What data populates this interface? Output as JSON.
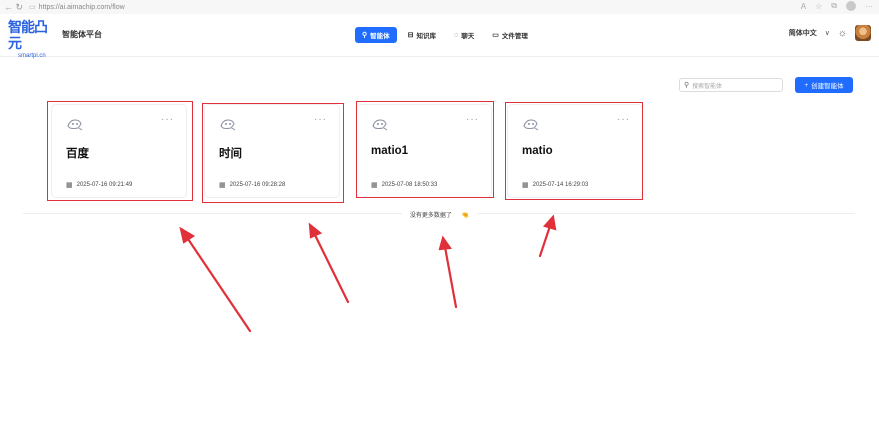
{
  "browser": {
    "url": "https://ai.aimachip.com/flow"
  },
  "header": {
    "logo_text": "智能凸元",
    "logo_sub": "smartpi.cn",
    "platform_name": "智能体平台",
    "nav": [
      {
        "label": "智能体",
        "active": true,
        "icon": "agent-icon"
      },
      {
        "label": "知识库",
        "active": false,
        "icon": "database-icon"
      },
      {
        "label": "聊天",
        "active": false,
        "icon": "chat-icon"
      },
      {
        "label": "文件管理",
        "active": false,
        "icon": "folder-icon"
      }
    ],
    "language": "简体中文"
  },
  "toolbar": {
    "search_placeholder": "搜索智能体",
    "create_label": "创建智能体"
  },
  "agents": [
    {
      "name": "百度",
      "date": "2025-07-16 09:21:49"
    },
    {
      "name": "时间",
      "date": "2025-07-16 09:28:28"
    },
    {
      "name": "matio1",
      "date": "2025-07-08 18:50:33"
    },
    {
      "name": "matio",
      "date": "2025-07-14 16:29:03"
    }
  ],
  "list_end": {
    "message": "没有更多数据了",
    "emoji": "🤏"
  },
  "colors": {
    "accent": "#1f6cff",
    "annotation": "#e0303a"
  }
}
